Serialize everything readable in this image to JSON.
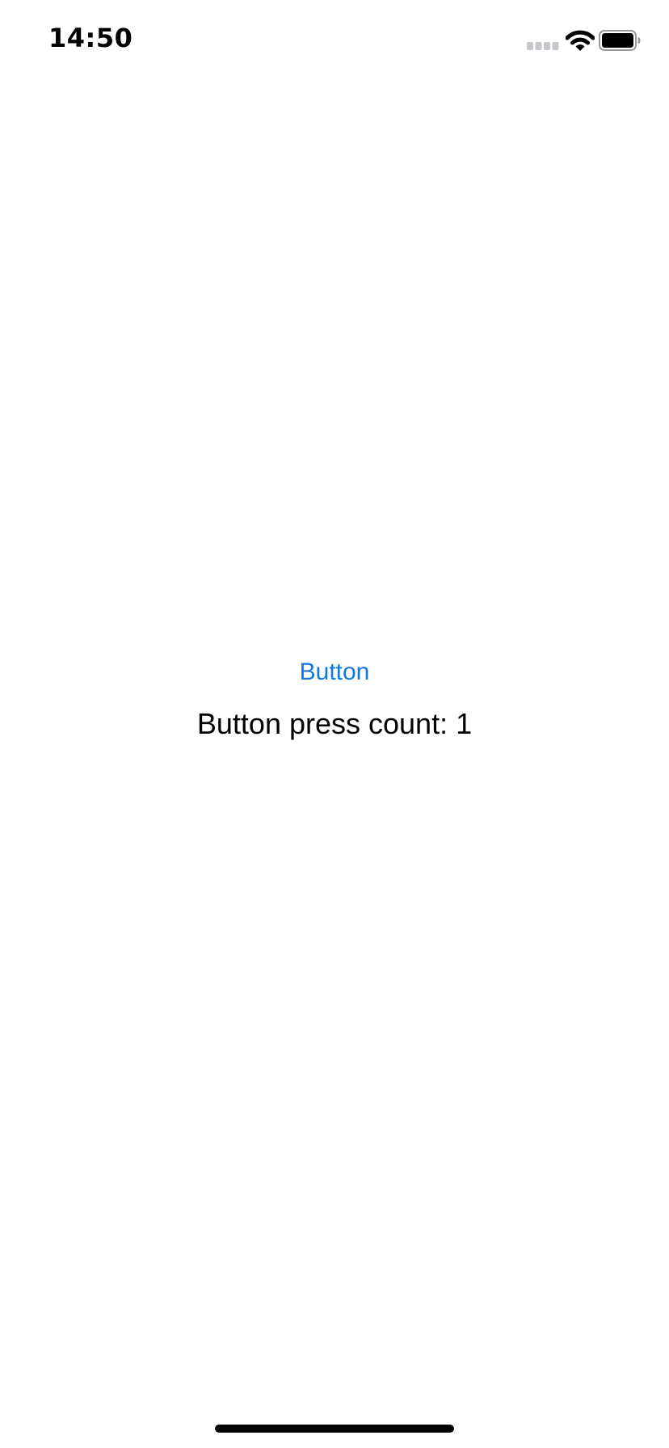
{
  "status_bar": {
    "time": "14:50",
    "icons": [
      "signal-icon",
      "wifi-icon",
      "battery-icon"
    ]
  },
  "main": {
    "button_label": "Button",
    "count_text": "Button press count: 1"
  },
  "colors": {
    "accent": "#1277DF",
    "text": "#000000",
    "background": "#FFFFFF",
    "inactive_signal": "#C7C7CC"
  }
}
